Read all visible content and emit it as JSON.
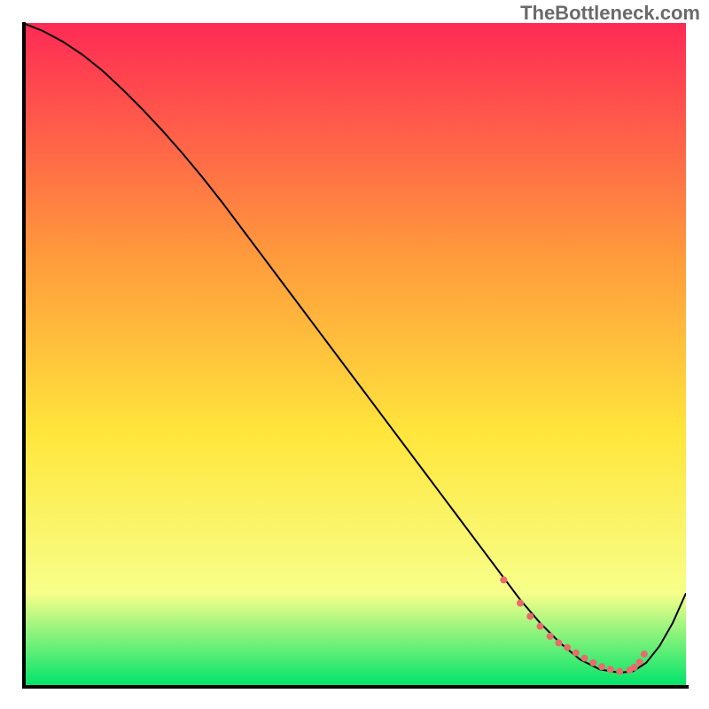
{
  "watermark": "TheBottleneck.com",
  "chart_data": {
    "type": "line",
    "title": "",
    "xlabel": "",
    "ylabel": "",
    "xlim": [
      0,
      100
    ],
    "ylim": [
      0,
      100
    ],
    "grid": false,
    "gradient_colors": {
      "top": "#ff2a55",
      "upper_mid": "#ff9a3c",
      "mid": "#ffe63c",
      "lower": "#f7ff8a",
      "bottom": "#00e46a"
    },
    "series": [
      {
        "name": "bottleneck-curve",
        "color": "#000000",
        "width": 2,
        "x": [
          0,
          3,
          6,
          9,
          12,
          15,
          18,
          21,
          24,
          27,
          30,
          33,
          36,
          39,
          42,
          45,
          48,
          51,
          54,
          57,
          60,
          63,
          66,
          69,
          72,
          75,
          78,
          81,
          84,
          87,
          90,
          92,
          94,
          96,
          98,
          100
        ],
        "y": [
          100,
          98.8,
          97.2,
          95.2,
          92.8,
          90.0,
          87.0,
          83.8,
          80.4,
          76.8,
          73.0,
          69.0,
          65.0,
          61.0,
          57.0,
          53.0,
          49.0,
          45.0,
          41.0,
          37.0,
          33.0,
          29.0,
          25.0,
          21.0,
          17.0,
          13.0,
          9.5,
          6.5,
          4.0,
          2.5,
          2.0,
          2.2,
          3.5,
          6.0,
          9.5,
          14.0
        ]
      },
      {
        "name": "highlight-dots",
        "color": "#e86c6c",
        "type": "scatter",
        "marker_size": 8,
        "x": [
          72.5,
          75.0,
          76.5,
          78.0,
          79.5,
          80.8,
          82.1,
          83.4,
          84.7,
          86.0,
          87.3,
          88.6,
          90.0,
          91.5,
          92.2,
          93.0,
          93.7
        ],
        "y": [
          16.0,
          12.5,
          10.5,
          9.0,
          7.5,
          6.5,
          5.8,
          5.0,
          4.2,
          3.5,
          2.9,
          2.5,
          2.2,
          2.4,
          2.8,
          3.6,
          4.8
        ]
      }
    ]
  }
}
